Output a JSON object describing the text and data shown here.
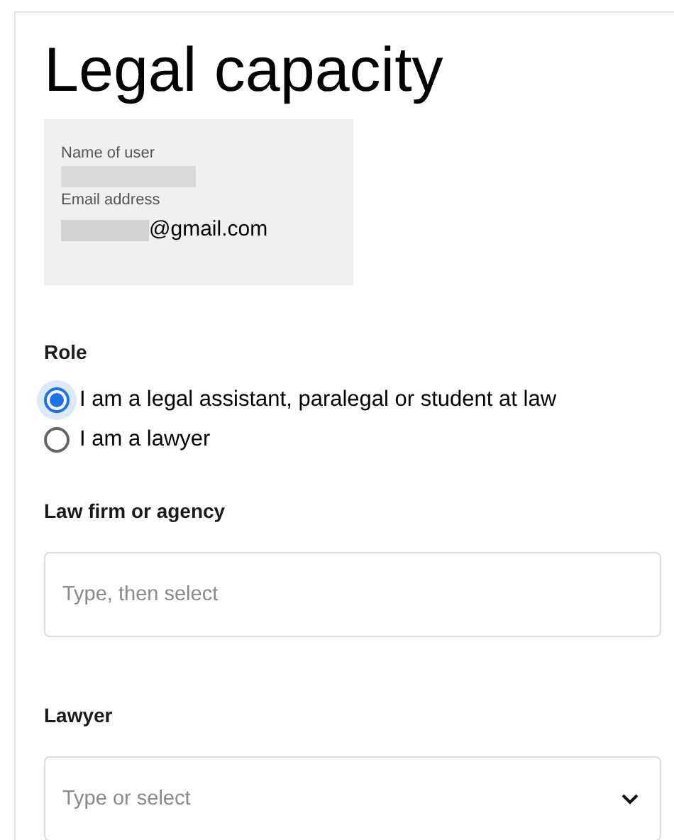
{
  "title": "Legal capacity",
  "user_info": {
    "name_label": "Name of user",
    "name_redacted": true,
    "email_label": "Email address",
    "email_redacted": true,
    "email_domain": "@gmail.com"
  },
  "role": {
    "label": "Role",
    "options": [
      {
        "label": "I am a legal assistant, paralegal or student at law",
        "selected": true
      },
      {
        "label": "I am a lawyer",
        "selected": false
      }
    ]
  },
  "fields": [
    {
      "kind": "text",
      "label": "Law firm or agency",
      "placeholder": "Type, then select"
    },
    {
      "kind": "select",
      "label": "Lawyer",
      "placeholder": "Type or select"
    }
  ]
}
